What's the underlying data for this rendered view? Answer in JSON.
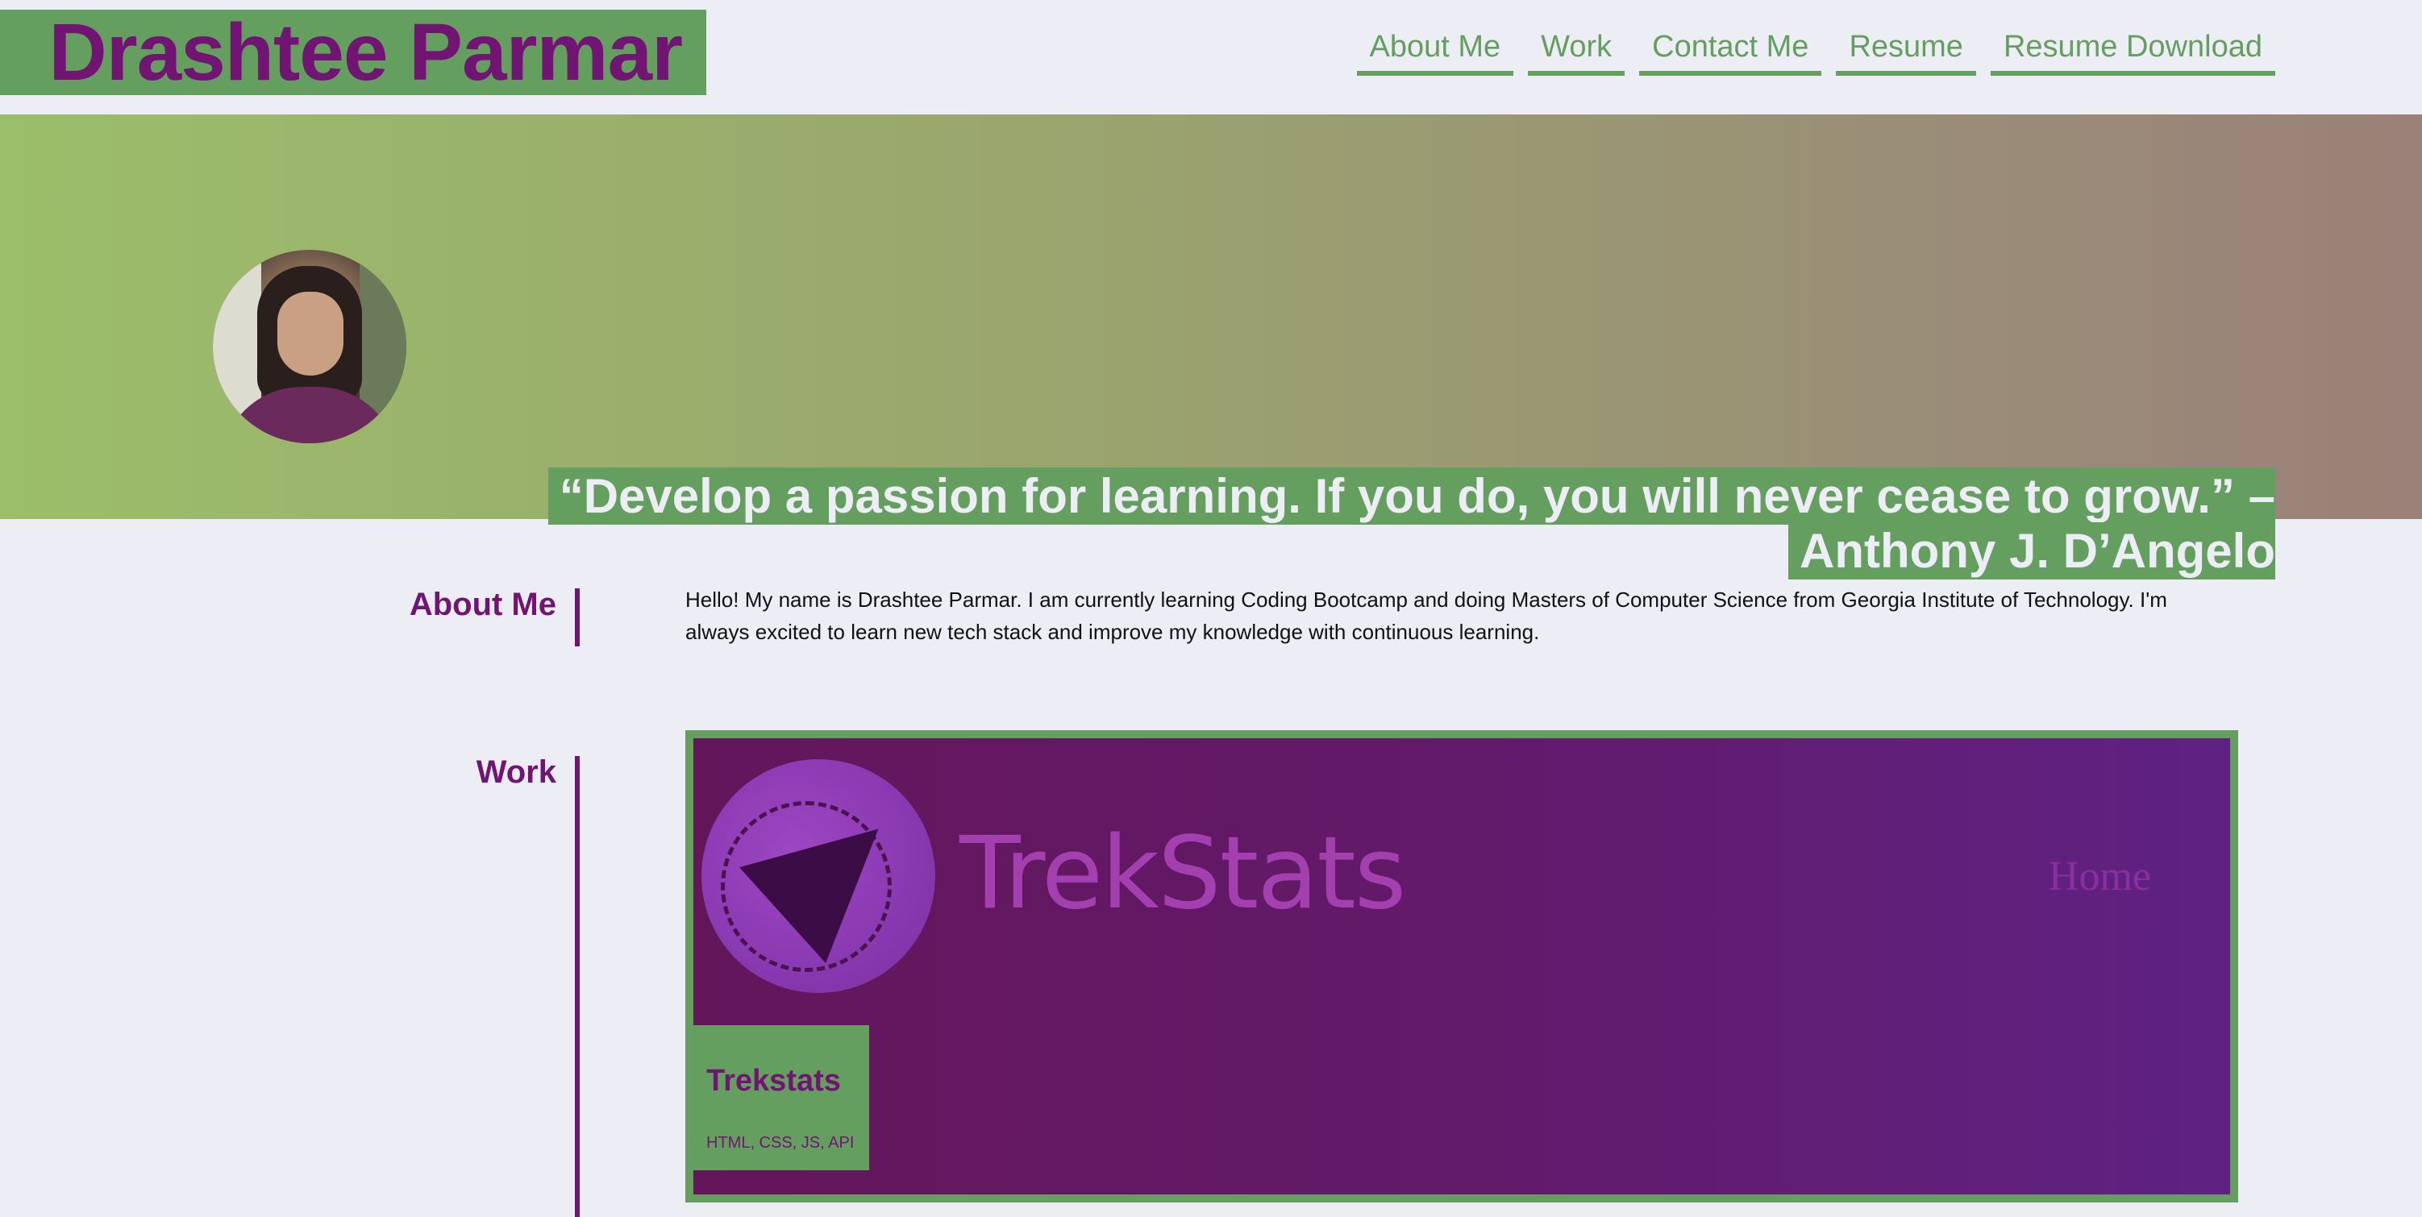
{
  "header": {
    "name": "Drashtee Parmar",
    "nav": [
      {
        "label": "About Me"
      },
      {
        "label": "Work"
      },
      {
        "label": "Contact Me"
      },
      {
        "label": "Resume"
      },
      {
        "label": "Resume Download"
      }
    ]
  },
  "hero": {
    "quote": "“Develop a passion for learning. If you do, you will never cease to grow.” – Anthony J. D’Angelo"
  },
  "about": {
    "label": "About Me",
    "text": "Hello! My name is Drashtee Parmar. I am currently learning Coding Bootcamp and doing Masters of Computer Science from Georgia Institute of Technology. I'm always excited to learn new tech stack and improve my knowledge with continuous learning."
  },
  "work": {
    "label": "Work",
    "projects": [
      {
        "screenshot_title": "TrekStats",
        "screenshot_nav": "Home",
        "name": "Trekstats",
        "tech": "HTML, CSS, JS, API"
      }
    ]
  },
  "colors": {
    "primary": "#721474",
    "accent": "#659f5f",
    "background": "#ededf5"
  }
}
